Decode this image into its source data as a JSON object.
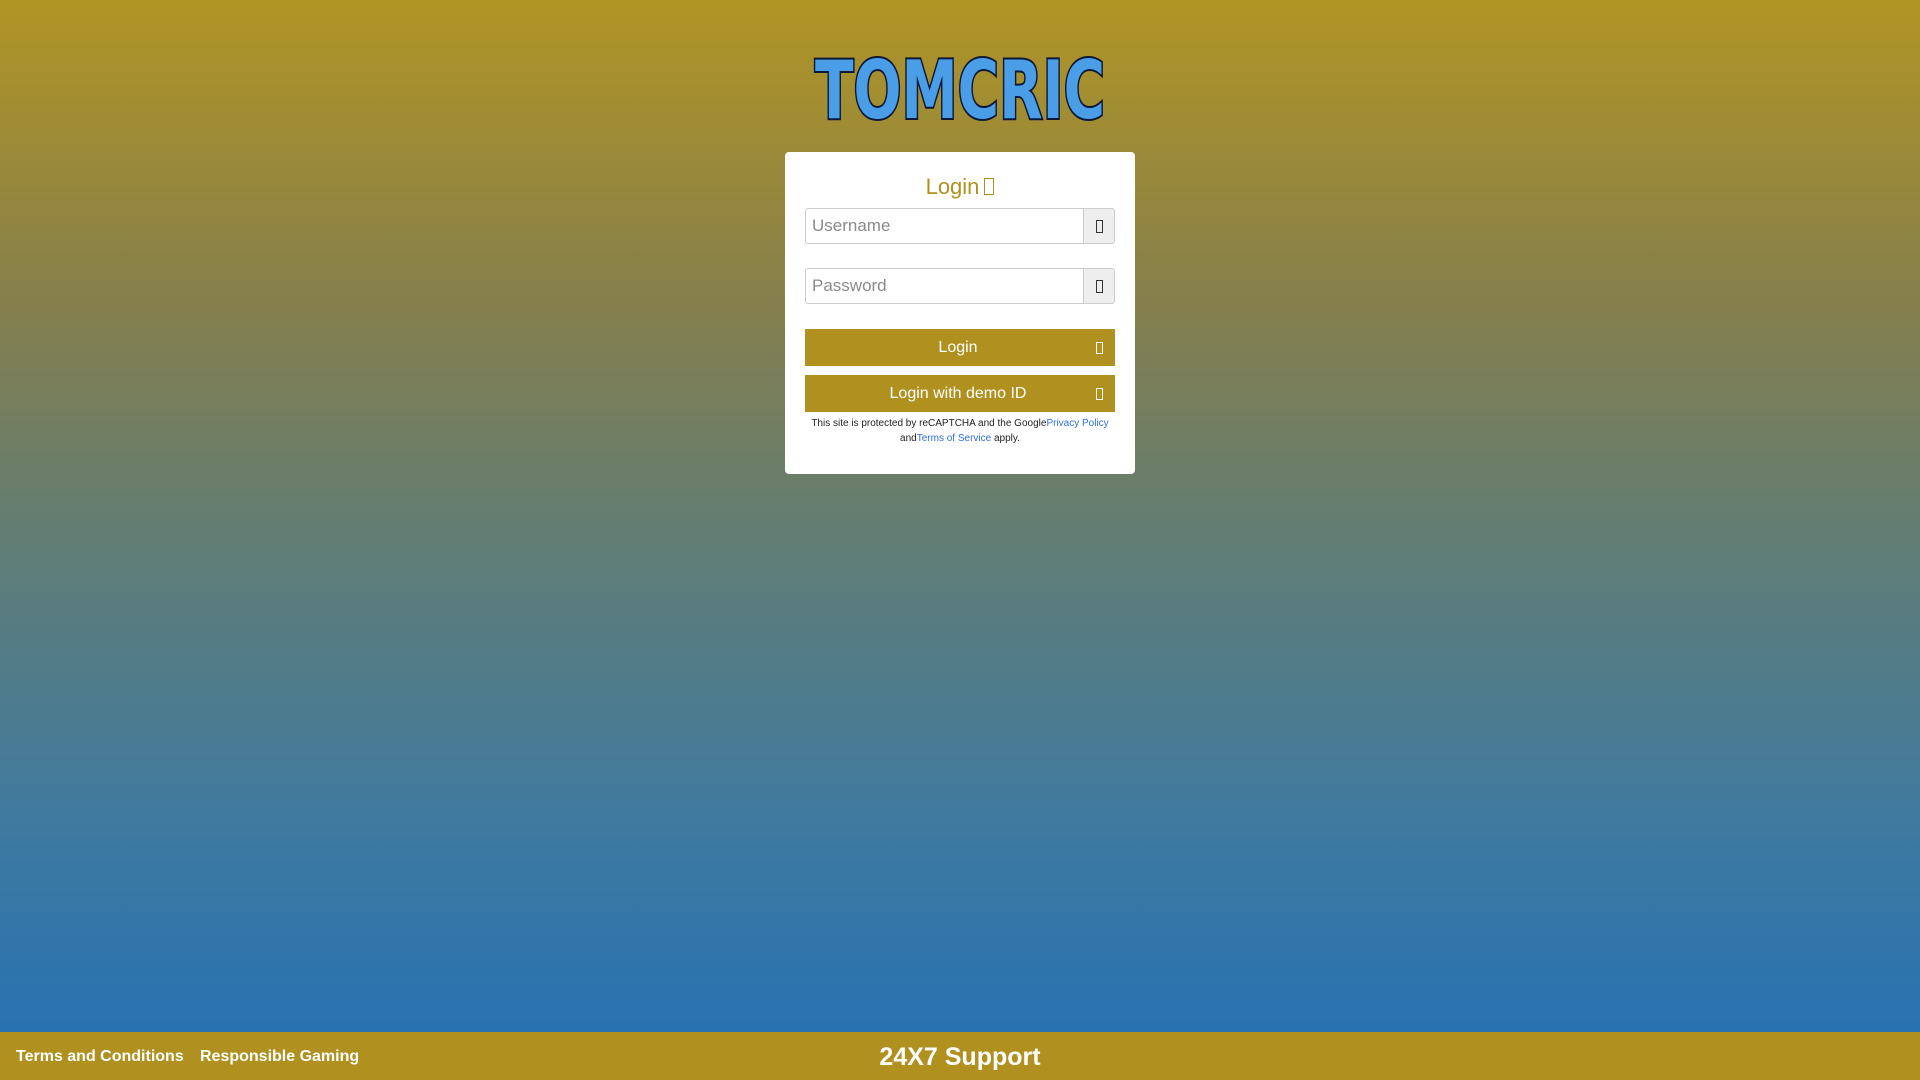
{
  "brand": {
    "logo_text": "TOMCRIC",
    "accent_color": "#b0911f",
    "logo_fill": "#4a9ee8"
  },
  "login_card": {
    "title": "Login",
    "title_icon": "sign-in-icon",
    "username": {
      "placeholder": "Username",
      "value": "",
      "icon": "user-icon"
    },
    "password": {
      "placeholder": "Password",
      "value": "",
      "icon": "key-icon"
    },
    "login_button": {
      "label": "Login",
      "icon": "sign-in-icon"
    },
    "demo_button": {
      "label": "Login with demo ID",
      "icon": "sign-in-icon"
    },
    "recaptcha": {
      "text_1": "This site is protected by reCAPTCHA and the Google",
      "privacy_link": "Privacy Policy",
      "text_2": "and",
      "terms_link": "Terms of Service",
      "text_3": " apply."
    }
  },
  "footer": {
    "links": [
      "Terms and Conditions",
      "Responsible Gaming"
    ],
    "support_label": "24X7 Support"
  }
}
